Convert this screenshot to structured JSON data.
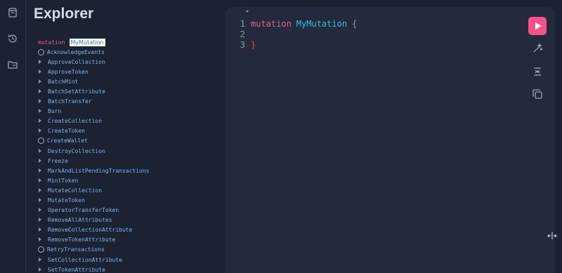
{
  "explorer": {
    "title": "Explorer",
    "operation_keyword": "mutation",
    "operation_name": "MyMutation",
    "fields": [
      {
        "label": "AcknowledgeEvents",
        "kind": "leaf"
      },
      {
        "label": "ApproveCollection",
        "kind": "expandable"
      },
      {
        "label": "ApproveToken",
        "kind": "expandable"
      },
      {
        "label": "BatchMint",
        "kind": "expandable"
      },
      {
        "label": "BatchSetAttribute",
        "kind": "expandable"
      },
      {
        "label": "BatchTransfer",
        "kind": "expandable"
      },
      {
        "label": "Burn",
        "kind": "expandable"
      },
      {
        "label": "CreateCollection",
        "kind": "expandable"
      },
      {
        "label": "CreateToken",
        "kind": "expandable"
      },
      {
        "label": "CreateWallet",
        "kind": "leaf"
      },
      {
        "label": "DestroyCollection",
        "kind": "expandable"
      },
      {
        "label": "Freeze",
        "kind": "expandable"
      },
      {
        "label": "MarkAndListPendingTransactions",
        "kind": "expandable"
      },
      {
        "label": "MintToken",
        "kind": "expandable"
      },
      {
        "label": "MutateCollection",
        "kind": "expandable"
      },
      {
        "label": "MutateToken",
        "kind": "expandable"
      },
      {
        "label": "OperatorTransferToken",
        "kind": "expandable"
      },
      {
        "label": "RemoveAllAttributes",
        "kind": "expandable"
      },
      {
        "label": "RemoveCollectionAttribute",
        "kind": "expandable"
      },
      {
        "label": "RemoveTokenAttribute",
        "kind": "expandable"
      },
      {
        "label": "RetryTransactions",
        "kind": "leaf"
      },
      {
        "label": "SetCollectionAttribute",
        "kind": "expandable"
      },
      {
        "label": "SetTokenAttribute",
        "kind": "expandable"
      }
    ]
  },
  "editor": {
    "lines": [
      {
        "number": "1",
        "keyword": "mutation",
        "name": "MyMutation",
        "punct": "{"
      },
      {
        "number": "2"
      },
      {
        "number": "3",
        "brace": "}"
      }
    ]
  },
  "icons": {
    "rail": [
      "docs-icon",
      "history-icon",
      "explorer-folder-icon"
    ],
    "toolbar": [
      "run-icon",
      "prettify-icon",
      "merge-fragments-icon",
      "copy-icon"
    ]
  },
  "colors": {
    "background": "#1b2232",
    "editor_background": "#222a3b",
    "run_button": "#f7508b",
    "keyword": "#e85d8c",
    "name": "#2ec1df",
    "field": "#7cb5ee"
  }
}
